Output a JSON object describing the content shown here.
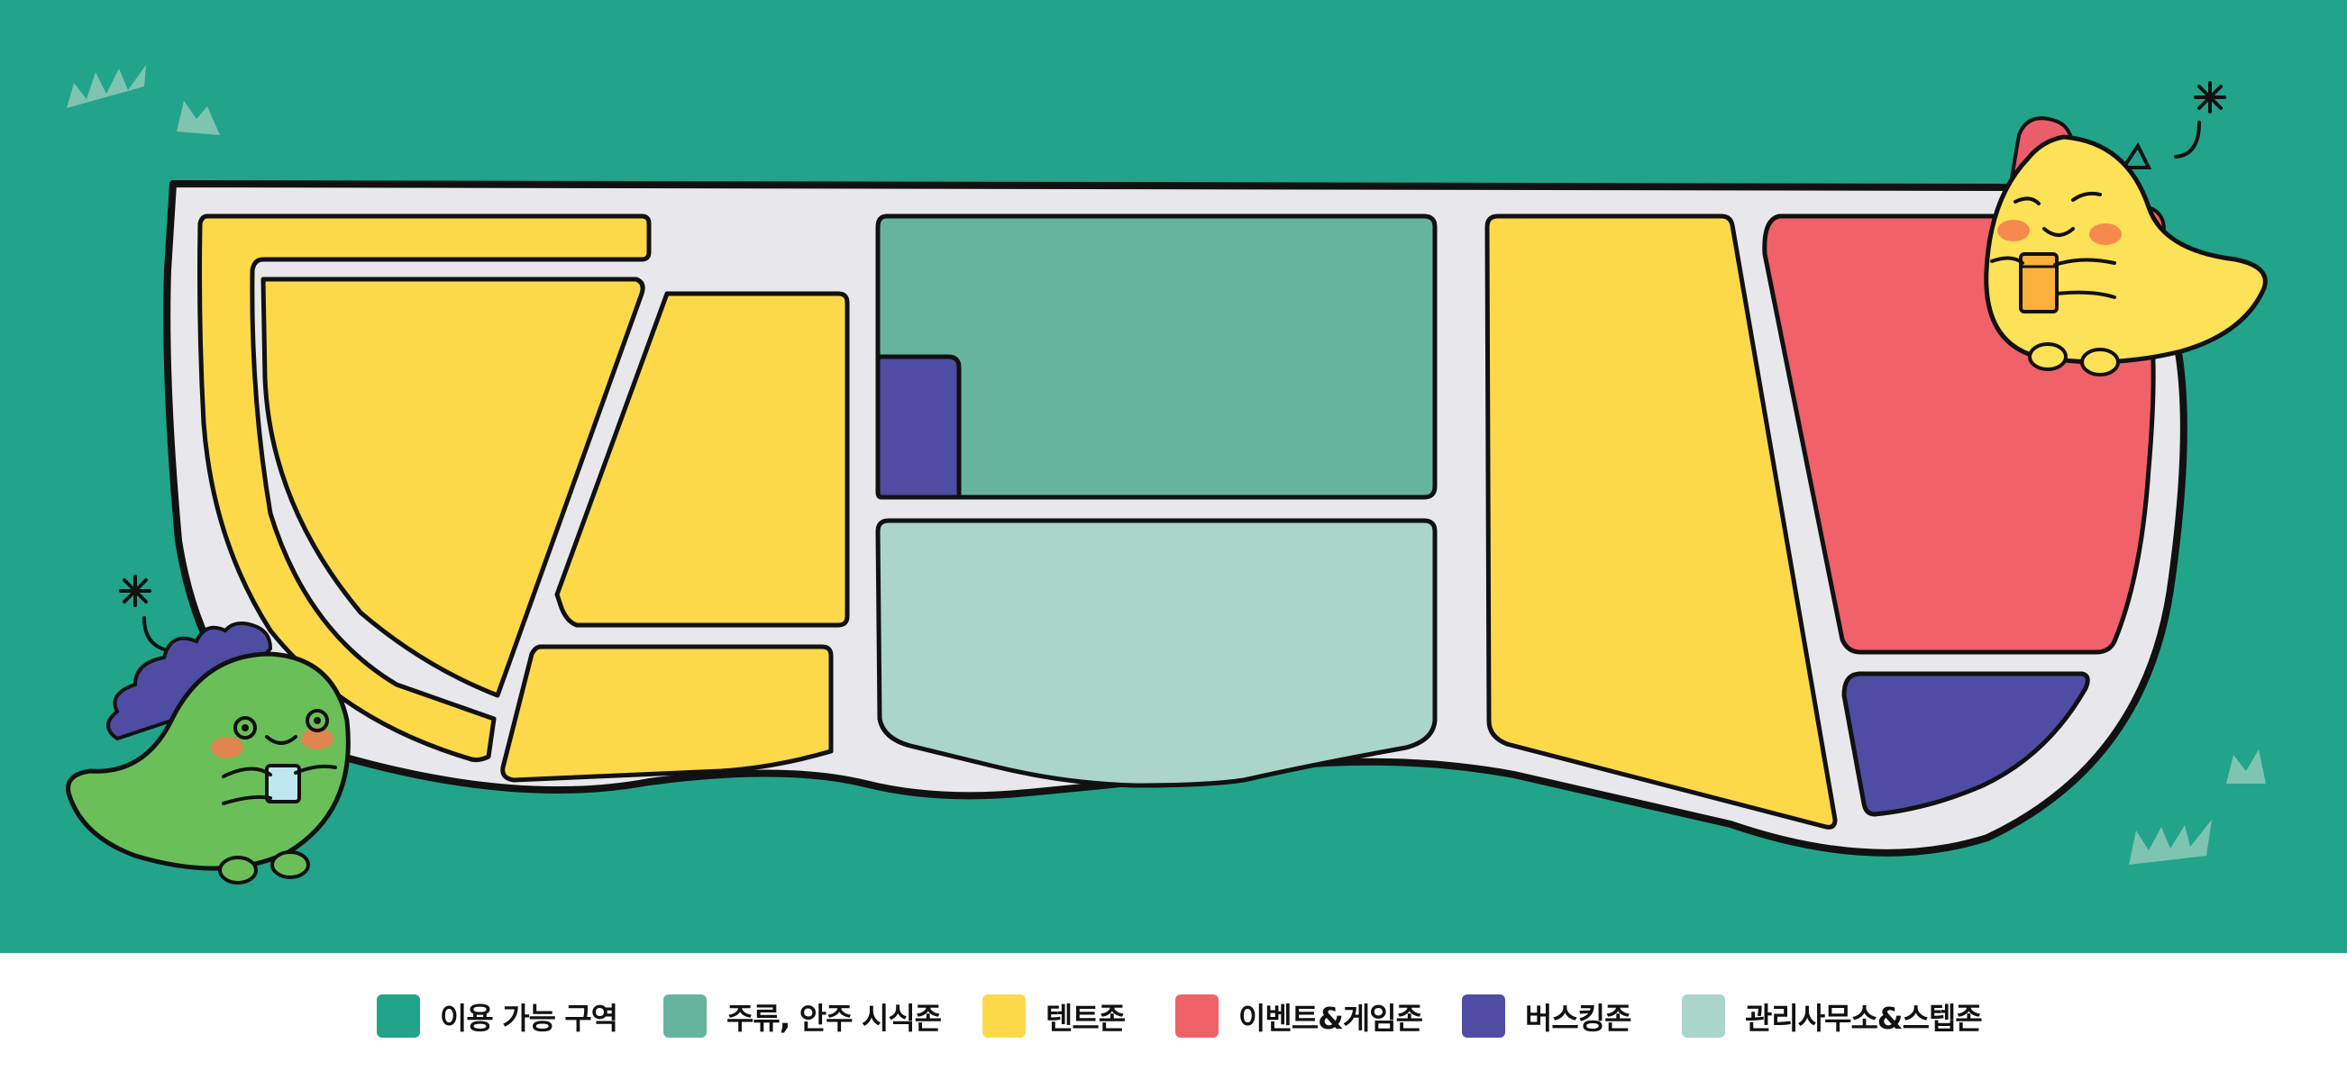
{
  "colors": {
    "background_green": "#21a48a",
    "road_gray": "#e8e8ec",
    "outline": "#111111",
    "drinking_zone": "#67b49e",
    "tent_zone": "#fdd94a",
    "event_game_zone": "#f1616a",
    "busking_zone": "#4e4da3",
    "office_step_zone": "#acd5c9",
    "grass_tuft": "#7fc3b1",
    "dino_green": "#6bbf58",
    "dino_spikes_purple": "#4e4da3",
    "dino_yellow": "#fde157",
    "dino_spikes_red": "#ec5d6b",
    "cheek_orange": "#f47a4c"
  },
  "legend": [
    {
      "label": "이용 가능 구역",
      "color": "#21a48a"
    },
    {
      "label": "주류, 안주 시식존",
      "color": "#67b49e"
    },
    {
      "label": "텐트존",
      "color": "#fdd94a"
    },
    {
      "label": "이벤트&게임존",
      "color": "#f1616a"
    },
    {
      "label": "버스킹존",
      "color": "#4e4da3"
    },
    {
      "label": "관리사무소&스텝존",
      "color": "#acd5c9"
    }
  ],
  "mascots": [
    {
      "name": "green-dinosaur",
      "holding": "drink-cup"
    },
    {
      "name": "yellow-dinosaur",
      "holding": "beer-glass"
    }
  ]
}
